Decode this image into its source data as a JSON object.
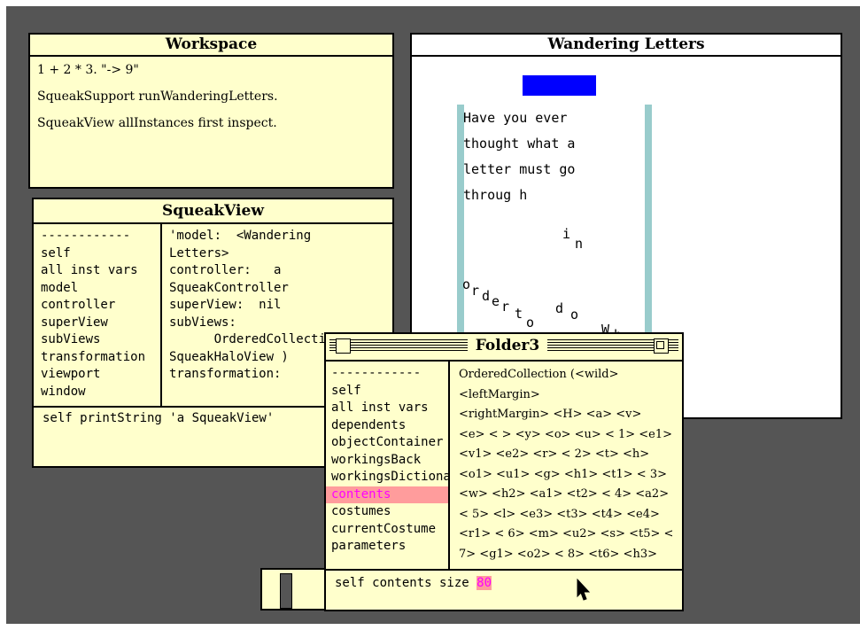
{
  "workspace": {
    "title": "Workspace",
    "lines": [
      "1 + 2 * 3. \"-> 9\"",
      "",
      "SqueakSupport runWanderingLetters.",
      "",
      "SqueakView allInstances first inspect."
    ]
  },
  "wandering": {
    "title": "Wandering Letters",
    "text_lines": [
      "Have you ever",
      "thought what a",
      "letter must go",
      "throug h"
    ],
    "letters": [
      "i",
      "n",
      "o",
      "r",
      "d",
      "e",
      "r",
      "t",
      "o",
      "d",
      "o",
      "W",
      "h"
    ]
  },
  "squeakview": {
    "title": "SqueakView",
    "list": [
      "------------",
      "self",
      "all inst vars",
      "model",
      "controller",
      "superView",
      "subViews",
      "transformation",
      "viewport",
      "window"
    ],
    "value_lines": [
      "'model:  <Wandering",
      "Letters>",
      "controller:   a",
      "SqueakController",
      "superView:  nil",
      "subViews:",
      "      OrderedCollection",
      "SqueakHaloView )",
      "transformation:"
    ],
    "eval": "self printString 'a SqueakView'"
  },
  "folder3": {
    "title": "Folder3",
    "list": [
      "------------",
      "self",
      "all inst vars",
      "dependents",
      "objectContainer",
      "workingsBack",
      "workingsDictionary",
      "contents",
      "costumes",
      "currentCostume",
      "parameters"
    ],
    "selected": "contents",
    "value_lines": [
      "OrderedCollection (<wild>",
      "<leftMargin>",
      "<rightMargin> <H> <a> <v>",
      "<e> < > <y> <o> <u> < 1> <e1>",
      "<v1> <e2> <r> < 2> <t> <h>",
      "<o1> <u1> <g> <h1> <t1> < 3>",
      "<w> <h2> <a1> <t2> < 4> <a2>",
      "< 5> <l> <e3> <t3> <t4> <e4>",
      "<r1> < 6> <m> <u2> <s> <t5> <",
      "7> <g1> <o2> < 8> <t6> <h3>"
    ],
    "eval_prefix": "self contents size",
    "eval_result": "80"
  },
  "colors": {
    "desktop": "#555555",
    "window_bg": "#ffffcc",
    "highlight": "#ff9c9c",
    "highlight_text": "#ff00ff",
    "blue_block": "#0000ff",
    "margin_bars": "#99cccc"
  }
}
